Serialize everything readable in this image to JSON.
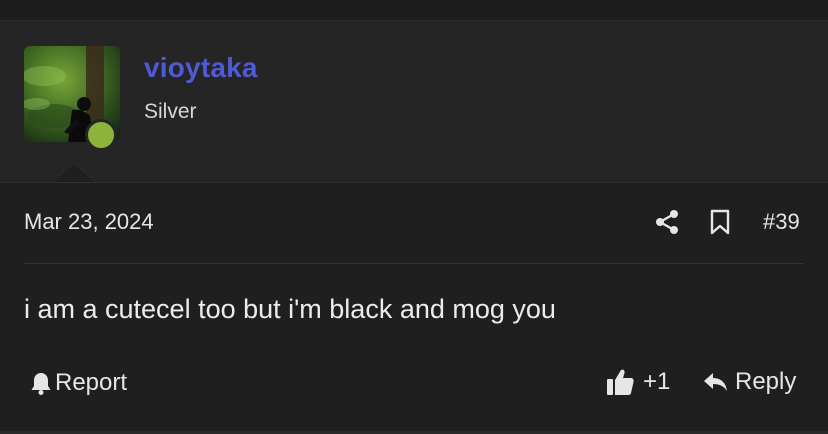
{
  "user": {
    "name": "vioytaka",
    "title": "Silver",
    "online_color": "#8cb33a",
    "avatar_icon": "dark-figure-green-forest-avatar"
  },
  "post": {
    "date": "Mar 23, 2024",
    "number": "#39",
    "message": "i am a cutecel too but i'm black and mog you",
    "share_icon": "share-icon",
    "bookmark_icon": "bookmark-icon"
  },
  "actions": {
    "report_label": "Report",
    "reaction_count": "+1",
    "reply_label": "Reply"
  },
  "colors": {
    "username": "#4f5bd5",
    "background": "#1f1f1f",
    "user_block": "#252525"
  }
}
